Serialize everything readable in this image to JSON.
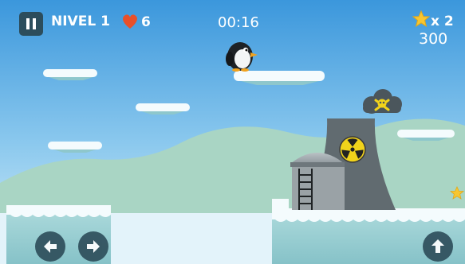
{
  "hud": {
    "level_label": "NIVEL 1",
    "lives": "6",
    "timer": "00:16",
    "stars": "x 2",
    "score": "300"
  },
  "colors": {
    "sky_top": "#3b97dc",
    "sky_bottom": "#bfe3f6",
    "hills": "#a9d5c4",
    "ice": "#9fd2d6",
    "snow": "#f4fbfd",
    "hud_panel": "#2c4d5c",
    "heart": "#e8502a",
    "star": "#f7c630",
    "tower": "#616b70",
    "radiation_yellow": "#f1d31b"
  },
  "icons": {
    "pause": "pause-icon",
    "lives": "heart-icon",
    "stars": "star-icon",
    "left": "arrow-left-icon",
    "right": "arrow-right-icon",
    "jump": "arrow-up-icon",
    "hazard": "radiation-icon",
    "pollution": "skull-crossbones-icon"
  }
}
